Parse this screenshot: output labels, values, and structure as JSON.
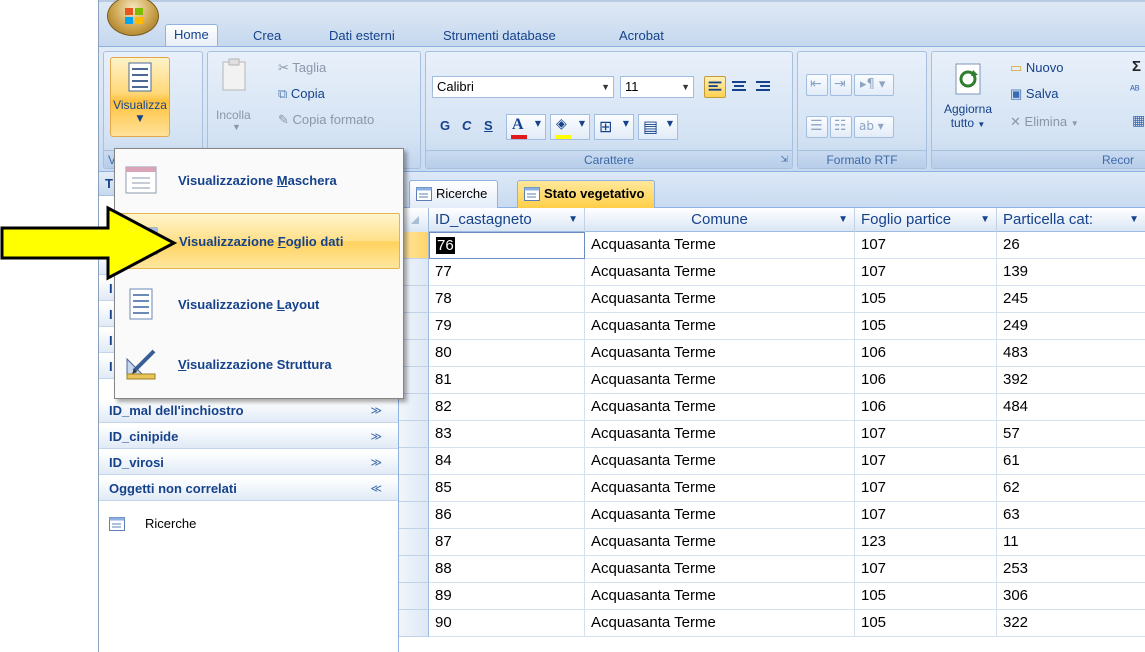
{
  "ribbon_tabs": [
    "Home",
    "Crea",
    "Dati esterni",
    "Strumenti database",
    "Acrobat"
  ],
  "ribbon": {
    "views_button": "Visualizza",
    "views_group_label": "Vi",
    "paste_label": "Incolla",
    "cut": "Taglia",
    "copy": "Copia",
    "format_painter": "Copia formato",
    "font_name": "Calibri",
    "font_size": "11",
    "bold": "G",
    "italic": "C",
    "underline": "S",
    "font_group_label": "Carattere",
    "rtf_group_label": "Formato RTF",
    "refresh_all_line1": "Aggiorna",
    "refresh_all_line2": "tutto",
    "new": "Nuovo",
    "save": "Salva",
    "delete": "Elimina",
    "records_group_label": "Recor"
  },
  "view_menu": {
    "items": [
      {
        "pre": "Visualizzazione ",
        "key": "M",
        "post": "aschera"
      },
      {
        "pre": "Visualizzazione ",
        "key": "F",
        "post": "oglio dati"
      },
      {
        "pre": "Visualizzazione ",
        "key": "L",
        "post": "ayout"
      },
      {
        "pre": "",
        "key": "V",
        "post": "isualizzazione Struttura"
      }
    ]
  },
  "nav_pane": {
    "header_letter": "T",
    "hidden_letters": [
      "I",
      "I",
      "I",
      "I",
      "I"
    ],
    "groups": [
      {
        "label": "ID_mal dell'inchiostro"
      },
      {
        "label": "ID_cinipide"
      },
      {
        "label": "ID_virosi"
      },
      {
        "label": "Oggetti non correlati"
      }
    ],
    "object": "Ricerche"
  },
  "doc_tabs": [
    "Ricerche",
    "Stato vegetativo"
  ],
  "table": {
    "columns": [
      "ID_castagneto",
      "Comune",
      "Foglio partice",
      "Particella cat:"
    ],
    "rows": [
      [
        "76",
        "Acquasanta Terme",
        "107",
        "26"
      ],
      [
        "77",
        "Acquasanta Terme",
        "107",
        "139"
      ],
      [
        "78",
        "Acquasanta Terme",
        "105",
        "245"
      ],
      [
        "79",
        "Acquasanta Terme",
        "105",
        "249"
      ],
      [
        "80",
        "Acquasanta Terme",
        "106",
        "483"
      ],
      [
        "81",
        "Acquasanta Terme",
        "106",
        "392"
      ],
      [
        "82",
        "Acquasanta Terme",
        "106",
        "484"
      ],
      [
        "83",
        "Acquasanta Terme",
        "107",
        "57"
      ],
      [
        "84",
        "Acquasanta Terme",
        "107",
        "61"
      ],
      [
        "85",
        "Acquasanta Terme",
        "107",
        "62"
      ],
      [
        "86",
        "Acquasanta Terme",
        "107",
        "63"
      ],
      [
        "87",
        "Acquasanta Terme",
        "123",
        "11"
      ],
      [
        "88",
        "Acquasanta Terme",
        "107",
        "253"
      ],
      [
        "89",
        "Acquasanta Terme",
        "105",
        "306"
      ],
      [
        "90",
        "Acquasanta Terme",
        "105",
        "322"
      ]
    ]
  },
  "colors": {
    "ribbon_blue": "#15428b",
    "highlight": "#ffd25e",
    "pointer_arrow": "#ffff00"
  }
}
